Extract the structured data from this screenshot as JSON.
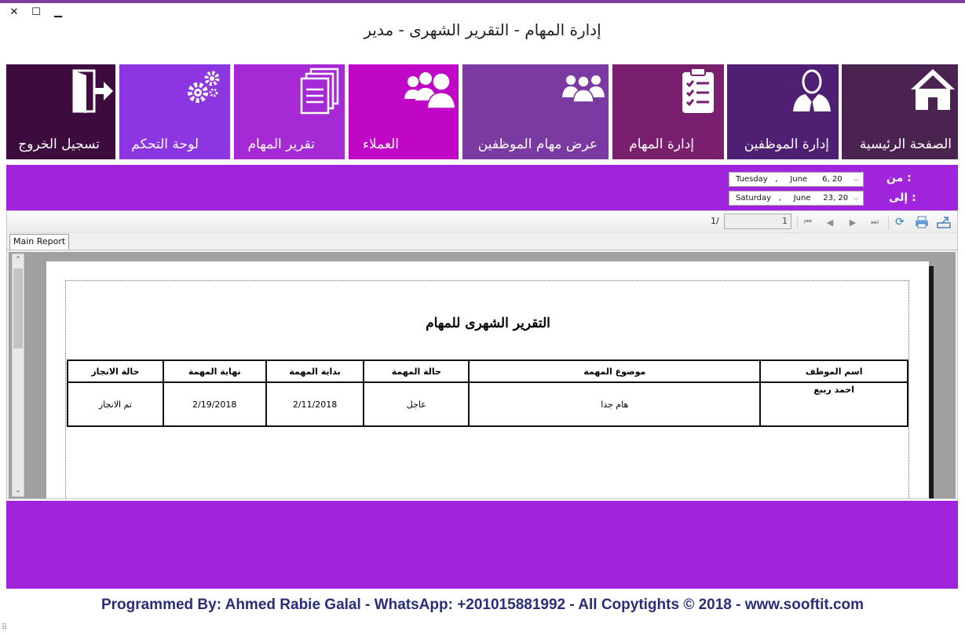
{
  "window": {
    "title": "إدارة المهام - التقرير الشهرى - مدير",
    "controls": {
      "close": "✕",
      "maximize": "☐",
      "minimize": "▁"
    }
  },
  "tiles": [
    {
      "id": "home",
      "label": "الصفحة الرئيسية",
      "icon": "home-icon",
      "color": "#4b2351"
    },
    {
      "id": "employees",
      "label": "إدارة الموظفين",
      "icon": "employee-icon",
      "color": "#4e1f73"
    },
    {
      "id": "tasks",
      "label": "إدارة المهام",
      "icon": "clipboard-checklist-icon",
      "color": "#7a1e6e"
    },
    {
      "id": "view-employee-tasks",
      "label": "عرض مهام الموظفين",
      "icon": "group-icon",
      "color": "#7a3aa1"
    },
    {
      "id": "customers",
      "label": "العملاء",
      "icon": "customers-icon",
      "color": "#c006c6"
    },
    {
      "id": "task-reports",
      "label": "تقرير المهام",
      "icon": "documents-icon",
      "color": "#a52ad5"
    },
    {
      "id": "control-panel",
      "label": "لوحة التحكم",
      "icon": "gears-icon",
      "color": "#8b36e0"
    },
    {
      "id": "logout",
      "label": "تسجيل الخروج",
      "icon": "exit-door-icon",
      "color": "#3d0b3e"
    }
  ],
  "filters": {
    "from_label": "من :",
    "to_label": "إلى :",
    "from_value": "Tuesday   ,     June      6, 20",
    "to_value": "Saturday   ,     June     23, 20"
  },
  "viewer": {
    "page_of": "1/",
    "page_input": "1",
    "tab_label": "Main Report"
  },
  "report": {
    "title": "التقرير الشهرى للمهام",
    "headers": {
      "employee": "اسم الموظف",
      "subject": "موضوع  المهمة",
      "status": "حالة المهمة",
      "start": "بداية المهمة",
      "end": "نهاية المهمة",
      "completion": "حالة الانجاز"
    },
    "row": {
      "employee": "احمد ربيع",
      "subject": "هام جدا",
      "status": "عاجل",
      "start": "2/11/2018",
      "end": "2/19/2018",
      "completion": "تم الانجاز"
    }
  },
  "footer": {
    "credit": "Programmed By: Ahmed Rabie Galal - WhatsApp: +201015881992 - All Copytights © 2018 - www.sooftit.com"
  },
  "colors": {
    "accent_band": "#a024dc",
    "footer_text": "#2a2e7a"
  }
}
